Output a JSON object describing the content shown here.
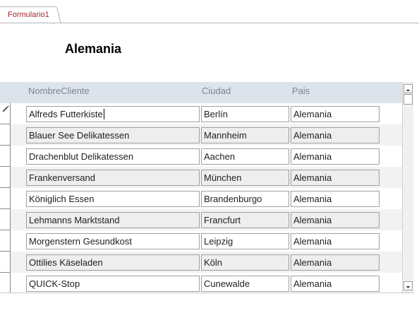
{
  "tab": {
    "label": "Formulario1"
  },
  "form": {
    "title": "Alemania"
  },
  "columns": {
    "nombre": "NombreCliente",
    "ciudad": "Ciudad",
    "pais": "Pais"
  },
  "rows": [
    {
      "nombre": "Alfreds Futterkiste",
      "ciudad": "Berlín",
      "pais": "Alemania"
    },
    {
      "nombre": "Blauer See Delikatessen",
      "ciudad": "Mannheim",
      "pais": "Alemania"
    },
    {
      "nombre": "Drachenblut Delikatessen",
      "ciudad": "Aachen",
      "pais": "Alemania"
    },
    {
      "nombre": "Frankenversand",
      "ciudad": "München",
      "pais": "Alemania"
    },
    {
      "nombre": "Königlich Essen",
      "ciudad": "Brandenburgo",
      "pais": "Alemania"
    },
    {
      "nombre": "Lehmanns Marktstand",
      "ciudad": "Francfurt",
      "pais": "Alemania"
    },
    {
      "nombre": "Morgenstern Gesundkost",
      "ciudad": "Leipzig",
      "pais": "Alemania"
    },
    {
      "nombre": "Ottilies Käseladen",
      "ciudad": "Köln",
      "pais": "Alemania"
    },
    {
      "nombre": "QUICK-Stop",
      "ciudad": "Cunewalde",
      "pais": "Alemania"
    }
  ],
  "icons": {
    "edit_indicator": "pencil-icon",
    "tab_icon": "form-icon"
  }
}
